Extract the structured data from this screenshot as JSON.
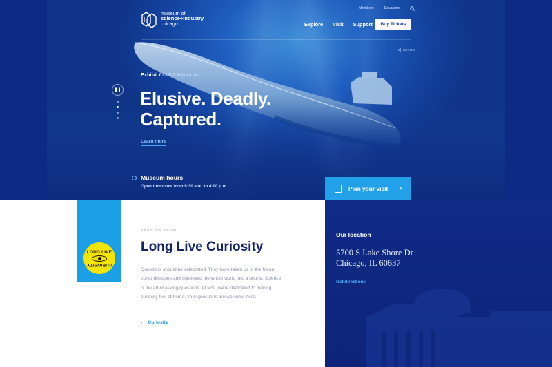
{
  "header": {
    "logo": {
      "line1": "museum of",
      "line2": "science+industry",
      "line3": "chicago"
    },
    "utility_links": [
      "Members",
      "Educators"
    ],
    "nav": [
      "Explore",
      "Visit",
      "Support"
    ],
    "buy_tickets": "Buy Tickets",
    "share": "SHARE"
  },
  "hero": {
    "eyebrow_prefix": "Exhibit /",
    "eyebrow_italic": "U-505 Submarine",
    "headline_line1": "Elusive. Deadly.",
    "headline_line2": "Captured.",
    "learn_more": "Learn more",
    "hours_title": "Museum hours",
    "hours_text": "Open tomorrow from 9:30 a.m. to 4:00 p.m.",
    "plan_visit": "Plan your visit",
    "slide_indicator": {
      "active_index": 1,
      "count": 4
    }
  },
  "need_to_know": {
    "eyebrow": "NEED TO KNOW",
    "badge_top": "LONG LIVE",
    "badge_bottom": "CURIOSITY",
    "title": "Long Live Curiosity",
    "body": "Questions should be celebrated. They have taken us to the Moon, cured diseases and squeezed the whole world into a phone. Science is the art of asking questions. At MSI, we're dedicated to making curiosity feel at home. Your questions are welcome here.",
    "link": "Curiosity"
  },
  "location": {
    "title": "Our location",
    "address_line1": "5700 S Lake Shore Dr",
    "address_line2": "Chicago, IL 60637",
    "directions": "Get directions"
  },
  "colors": {
    "accent": "#22a0e8",
    "navy": "#10236b",
    "badge_yellow": "#f4e500"
  }
}
